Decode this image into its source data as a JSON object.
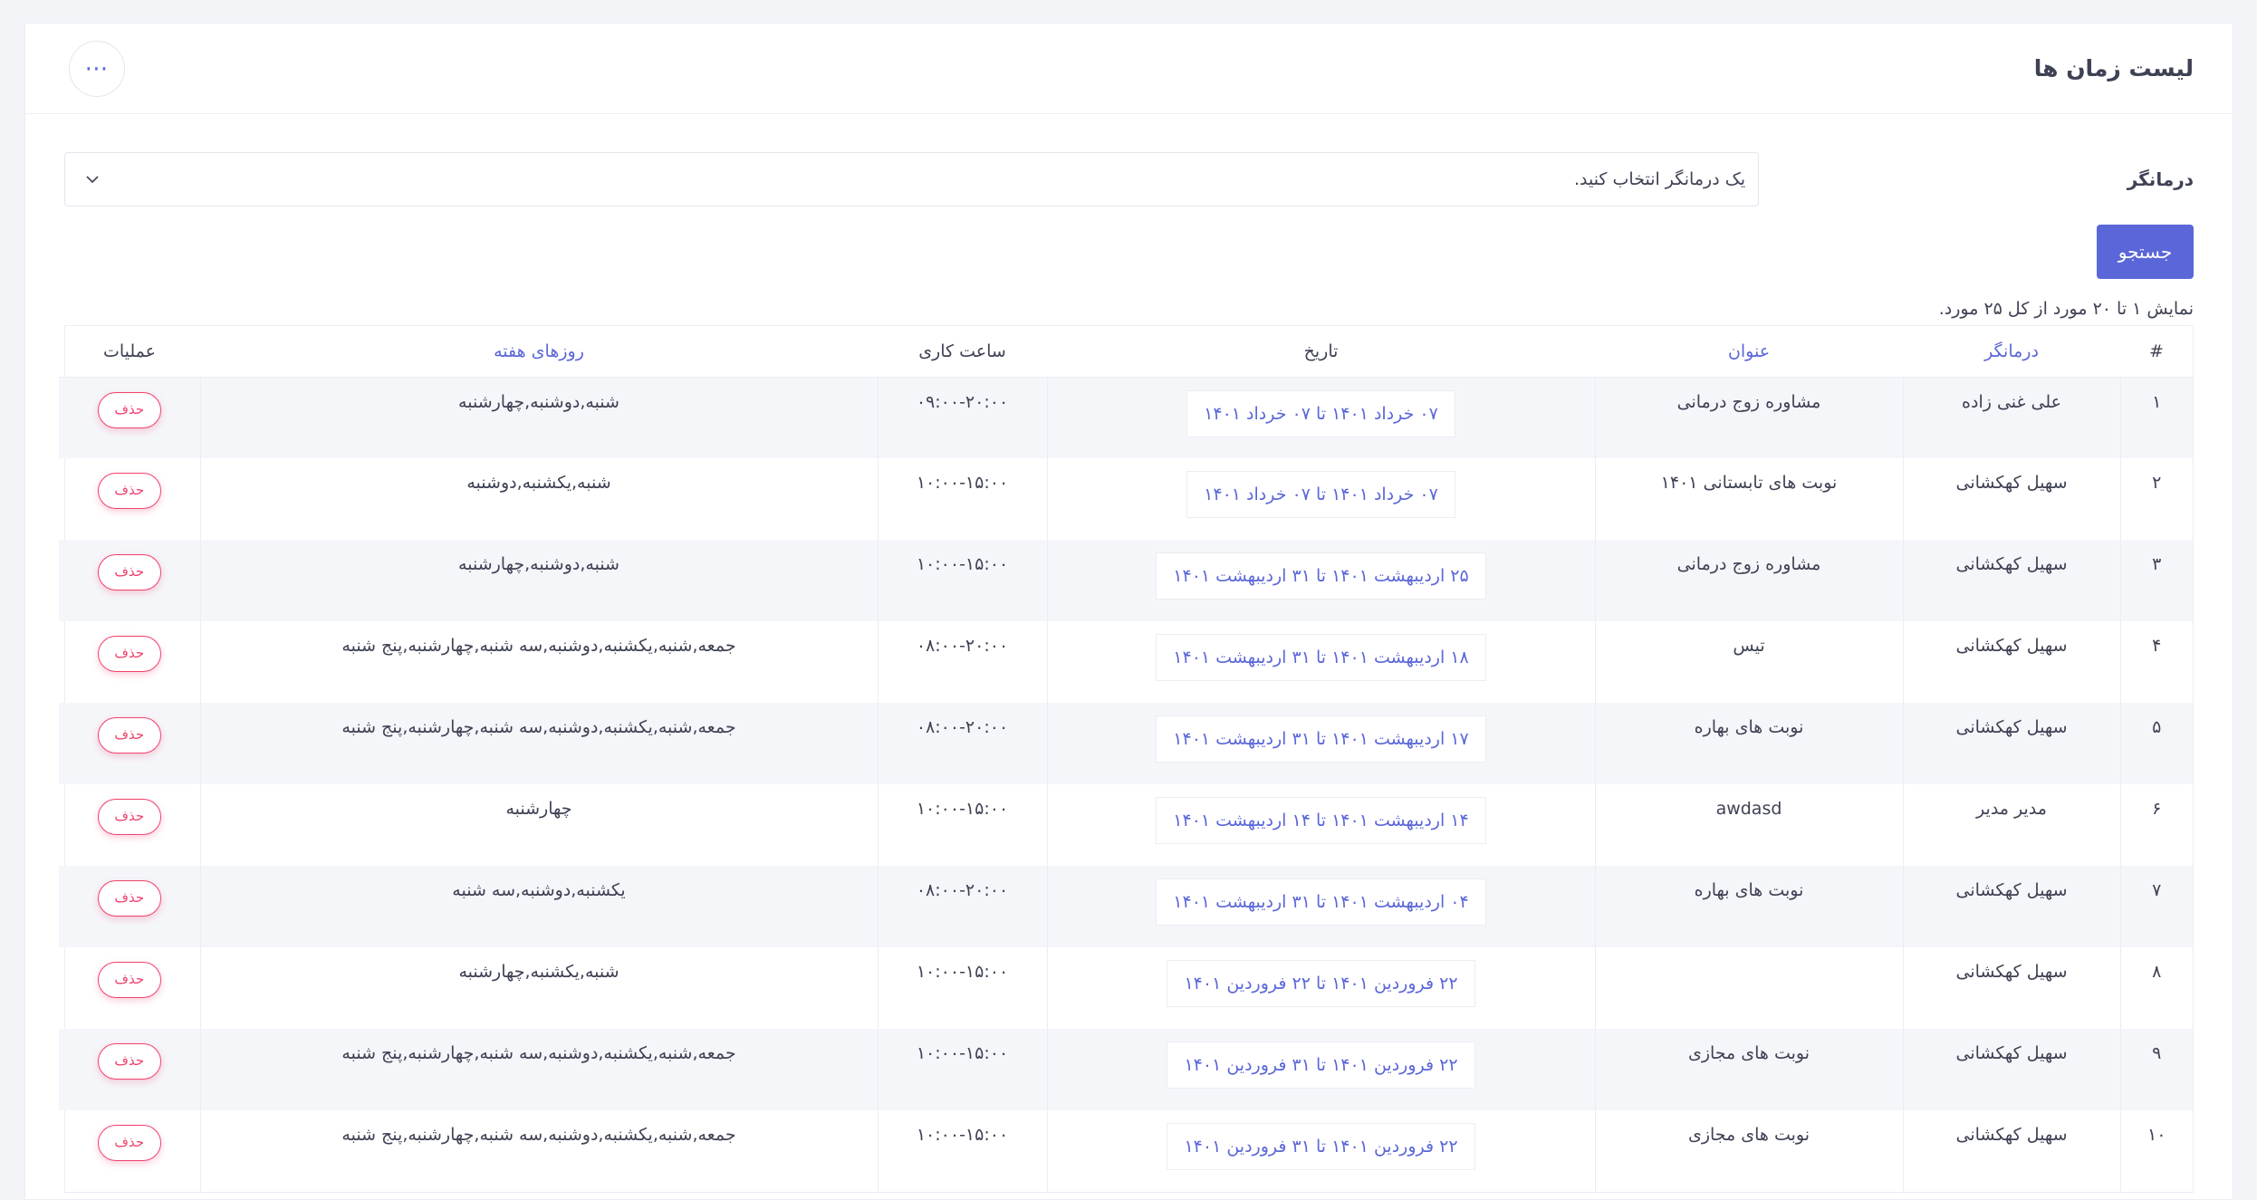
{
  "header": {
    "title": "لیست زمان ها",
    "more_label": "⋯"
  },
  "filter": {
    "label": "درمانگر",
    "select_value": "یک درمانگر انتخاب کنید."
  },
  "search_label": "جستجو",
  "summary": "نمایش ۱ تا ۲۰ مورد از کل ۲۵ مورد.",
  "table": {
    "columns": {
      "index": "#",
      "therapist": "درمانگر",
      "title": "عنوان",
      "date": "تاریخ",
      "hours": "ساعت کاری",
      "weekdays": "روزهای هفته",
      "ops": "عملیات"
    },
    "rows": [
      {
        "index": "۱",
        "therapist": "علی غنی زاده",
        "title": "مشاوره زوج درمانی",
        "date": "۰۷ خرداد ۱۴۰۱ تا ۰۷ خرداد ۱۴۰۱",
        "hours": "۰۹:۰۰-۲۰:۰۰",
        "weekdays": "شنبه,دوشنبه,چهارشنبه",
        "delete_label": "حذف"
      },
      {
        "index": "۲",
        "therapist": "سهیل کهکشانی",
        "title": "نوبت های تابستانی ۱۴۰۱",
        "date": "۰۷ خرداد ۱۴۰۱ تا ۰۷ خرداد ۱۴۰۱",
        "hours": "۱۰:۰۰-۱۵:۰۰",
        "weekdays": "شنبه,یکشنبه,دوشنبه",
        "delete_label": "حذف"
      },
      {
        "index": "۳",
        "therapist": "سهیل کهکشانی",
        "title": "مشاوره زوج درمانی",
        "date": "۲۵ اردیبهشت ۱۴۰۱ تا ۳۱ اردیبهشت ۱۴۰۱",
        "hours": "۱۰:۰۰-۱۵:۰۰",
        "weekdays": "شنبه,دوشنبه,چهارشنبه",
        "delete_label": "حذف"
      },
      {
        "index": "۴",
        "therapist": "سهیل کهکشانی",
        "title": "تیس",
        "date": "۱۸ اردیبهشت ۱۴۰۱ تا ۳۱ اردیبهشت ۱۴۰۱",
        "hours": "۰۸:۰۰-۲۰:۰۰",
        "weekdays": "جمعه,شنبه,یکشنبه,دوشنبه,سه شنبه,چهارشنبه,پنج شنبه",
        "delete_label": "حذف"
      },
      {
        "index": "۵",
        "therapist": "سهیل کهکشانی",
        "title": "نوبت های بهاره",
        "date": "۱۷ اردیبهشت ۱۴۰۱ تا ۳۱ اردیبهشت ۱۴۰۱",
        "hours": "۰۸:۰۰-۲۰:۰۰",
        "weekdays": "جمعه,شنبه,یکشنبه,دوشنبه,سه شنبه,چهارشنبه,پنج شنبه",
        "delete_label": "حذف"
      },
      {
        "index": "۶",
        "therapist": "مدیر مدیر",
        "title": "awdasd",
        "date": "۱۴ اردیبهشت ۱۴۰۱ تا ۱۴ اردیبهشت ۱۴۰۱",
        "hours": "۱۰:۰۰-۱۵:۰۰",
        "weekdays": "چهارشنبه",
        "delete_label": "حذف"
      },
      {
        "index": "۷",
        "therapist": "سهیل کهکشانی",
        "title": "نوبت های بهاره",
        "date": "۰۴ اردیبهشت ۱۴۰۱ تا ۳۱ اردیبهشت ۱۴۰۱",
        "hours": "۰۸:۰۰-۲۰:۰۰",
        "weekdays": "یکشنبه,دوشنبه,سه شنبه",
        "delete_label": "حذف"
      },
      {
        "index": "۸",
        "therapist": "سهیل کهکشانی",
        "title": "",
        "date": "۲۲ فروردین ۱۴۰۱ تا ۲۲ فروردین ۱۴۰۱",
        "hours": "۱۰:۰۰-۱۵:۰۰",
        "weekdays": "شنبه,یکشنبه,چهارشنبه",
        "delete_label": "حذف"
      },
      {
        "index": "۹",
        "therapist": "سهیل کهکشانی",
        "title": "نوبت های مجازی",
        "date": "۲۲ فروردین ۱۴۰۱ تا ۳۱ فروردین ۱۴۰۱",
        "hours": "۱۰:۰۰-۱۵:۰۰",
        "weekdays": "جمعه,شنبه,یکشنبه,دوشنبه,سه شنبه,چهارشنبه,پنج شنبه",
        "delete_label": "حذف"
      },
      {
        "index": "۱۰",
        "therapist": "سهیل کهکشانی",
        "title": "نوبت های مجازی",
        "date": "۲۲ فروردین ۱۴۰۱ تا ۳۱ فروردین ۱۴۰۱",
        "hours": "۱۰:۰۰-۱۵:۰۰",
        "weekdays": "جمعه,شنبه,یکشنبه,دوشنبه,سه شنبه,چهارشنبه,پنج شنبه",
        "delete_label": "حذف"
      }
    ]
  }
}
